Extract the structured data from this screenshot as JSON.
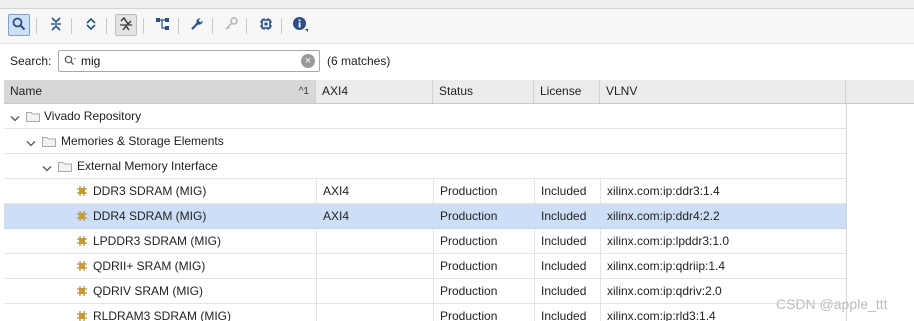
{
  "toolbar": {
    "buttons": [
      {
        "icon": "search-icon",
        "state": "active"
      },
      {
        "icon": "collapse-all-icon",
        "state": "normal"
      },
      {
        "icon": "expand-collapse-icon",
        "state": "normal"
      },
      {
        "icon": "filter-icon",
        "state": "highlighted"
      },
      {
        "icon": "hierarchy-icon",
        "state": "normal"
      },
      {
        "icon": "wrench-icon",
        "state": "normal"
      },
      {
        "icon": "key-icon",
        "state": "disabled"
      },
      {
        "icon": "chip-icon",
        "state": "normal"
      },
      {
        "icon": "info-icon",
        "state": "normal"
      }
    ]
  },
  "search": {
    "label": "Search:",
    "value": "mig",
    "clear_symbol": "×",
    "matches": "(6 matches)"
  },
  "table": {
    "columns": [
      {
        "label": "Name",
        "sort": "^1"
      },
      {
        "label": "AXI4"
      },
      {
        "label": "Status"
      },
      {
        "label": "License"
      },
      {
        "label": "VLNV"
      }
    ],
    "tree": [
      {
        "label": "Vivado Repository",
        "level": 0
      },
      {
        "label": "Memories & Storage Elements",
        "level": 1
      },
      {
        "label": "External Memory Interface",
        "level": 2
      }
    ],
    "rows": [
      {
        "name": "DDR3 SDRAM (MIG)",
        "axi4": "AXI4",
        "status": "Production",
        "license": "Included",
        "vlnv": "xilinx.com:ip:ddr3:1.4",
        "selected": false
      },
      {
        "name": "DDR4 SDRAM (MIG)",
        "axi4": "AXI4",
        "status": "Production",
        "license": "Included",
        "vlnv": "xilinx.com:ip:ddr4:2.2",
        "selected": true
      },
      {
        "name": "LPDDR3 SDRAM (MIG)",
        "axi4": "",
        "status": "Production",
        "license": "Included",
        "vlnv": "xilinx.com:ip:lpddr3:1.0",
        "selected": false
      },
      {
        "name": "QDRII+ SRAM (MIG)",
        "axi4": "",
        "status": "Production",
        "license": "Included",
        "vlnv": "xilinx.com:ip:qdriip:1.4",
        "selected": false
      },
      {
        "name": "QDRIV SRAM (MIG)",
        "axi4": "",
        "status": "Production",
        "license": "Included",
        "vlnv": "xilinx.com:ip:qdriv:2.0",
        "selected": false
      },
      {
        "name": "RLDRAM3 SDRAM (MIG)",
        "axi4": "",
        "status": "Production",
        "license": "Included",
        "vlnv": "xilinx.com:ip:rld3:1.4",
        "selected": false
      }
    ]
  },
  "watermark": "CSDN @apple_ttt",
  "colors": {
    "selection": "#cddff7",
    "accent": "#2a4f88",
    "ip_icon": "#c99a2e"
  }
}
